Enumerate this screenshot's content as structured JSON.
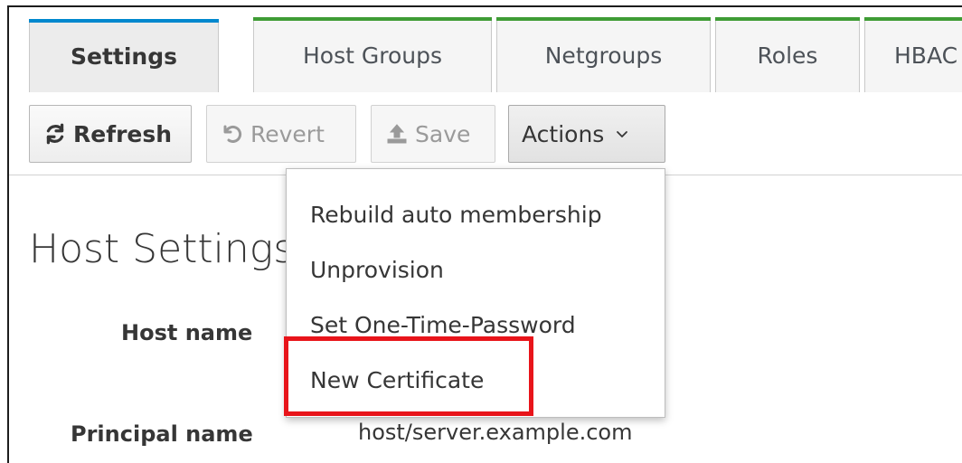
{
  "tabs": {
    "settings": "Settings",
    "host_groups": "Host Groups",
    "netgroups": "Netgroups",
    "roles": "Roles",
    "hbac": "HBAC"
  },
  "toolbar": {
    "refresh_label": "Refresh",
    "revert_label": "Revert",
    "save_label": "Save",
    "actions_label": "Actions",
    "actions_icon": "chevron-down-icon"
  },
  "page": {
    "title": "Host Settings"
  },
  "fields": {
    "host_name_label": "Host name",
    "principal_name_label": "Principal name",
    "principal_name_value": "host/server.example.com"
  },
  "actions_menu": {
    "items": [
      "Rebuild auto membership",
      "Unprovision",
      "Set One-Time-Password",
      "New Certificate"
    ]
  },
  "colors": {
    "active_tab_bar": "#0088ce",
    "tab_bar": "#3f9c35",
    "highlight": "#e8141a"
  }
}
